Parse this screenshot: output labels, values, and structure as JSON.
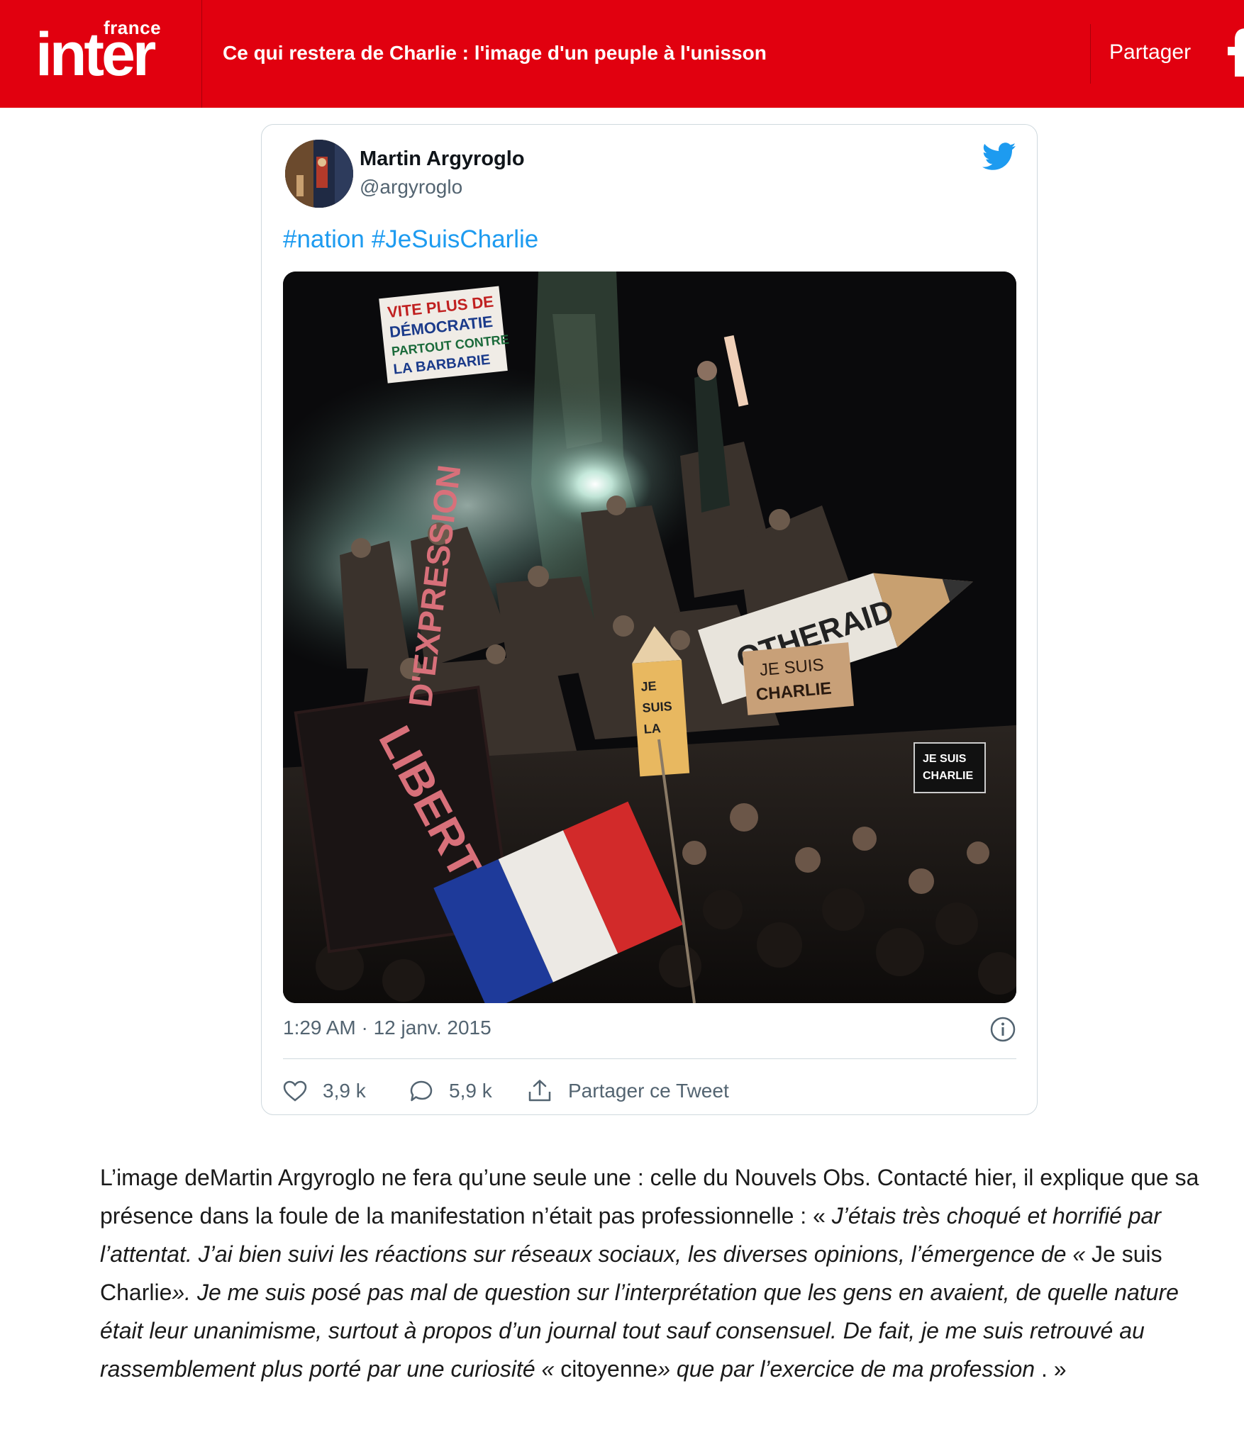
{
  "header": {
    "logo_small": "france",
    "logo_big": "inter",
    "title": "Ce qui restera de Charlie : l'image d'un peuple à l'unisson",
    "share_label": "Partager",
    "brand_color": "#e1000f"
  },
  "tweet": {
    "author_name": "Martin Argyroglo",
    "author_handle": "@argyroglo",
    "hashtags": [
      "#nation",
      "#JeSuisCharlie"
    ],
    "timestamp": "1:29 AM · 12 janv. 2015",
    "likes": "3,9 k",
    "replies": "5,9 k",
    "share_label": "Partager ce Tweet",
    "link_color": "#1d9bf0",
    "photo_signs": {
      "top_sign": [
        "VITE PLUS DE",
        "DÉMOCRATIE",
        "PARTOUT CONTRE",
        "LA BARBARIE"
      ],
      "left_sign": [
        "LIBERTÉ",
        "D'EXPRESSION"
      ],
      "right_sign": [
        "JE SUIS",
        "CHARLIE"
      ],
      "pencil_sign": [
        "JE",
        "SUIS",
        "LA"
      ],
      "pencil_text": "OTHERAID",
      "small_sign": [
        "JE SUIS",
        "CHARLIE"
      ]
    }
  },
  "article": {
    "intro": "L’image de",
    "name": "Martin Argyroglo",
    "after_name": " ne fera qu’une seule une : celle du Nouvels Obs. Contacté hier, il explique que sa présence dans la foule de la manifestation n’était pas professionnelle : « ",
    "quote1": "J’étais très choqué et horrifié par l’attentat. J’ai bien suivi les réactions sur réseaux sociaux, les diverses opinions, l’émergence de ",
    "q_open1": "« ",
    "inner1": "Je suis Charlie",
    "q_close1": "»",
    "quote2": ". Je me suis posé pas mal de question sur l’interprétation que les gens en avaient, de quelle nature était leur unanimisme, surtout à propos d’un journal tout sauf consensuel. De fait, je me suis retrouvé au rassemblement plus porté par une curiosité ",
    "q_open2": "« ",
    "inner2": "citoyenne",
    "q_close2": "»",
    "quote3": " que par l’exercice de ma profession",
    "ending": " . »"
  }
}
